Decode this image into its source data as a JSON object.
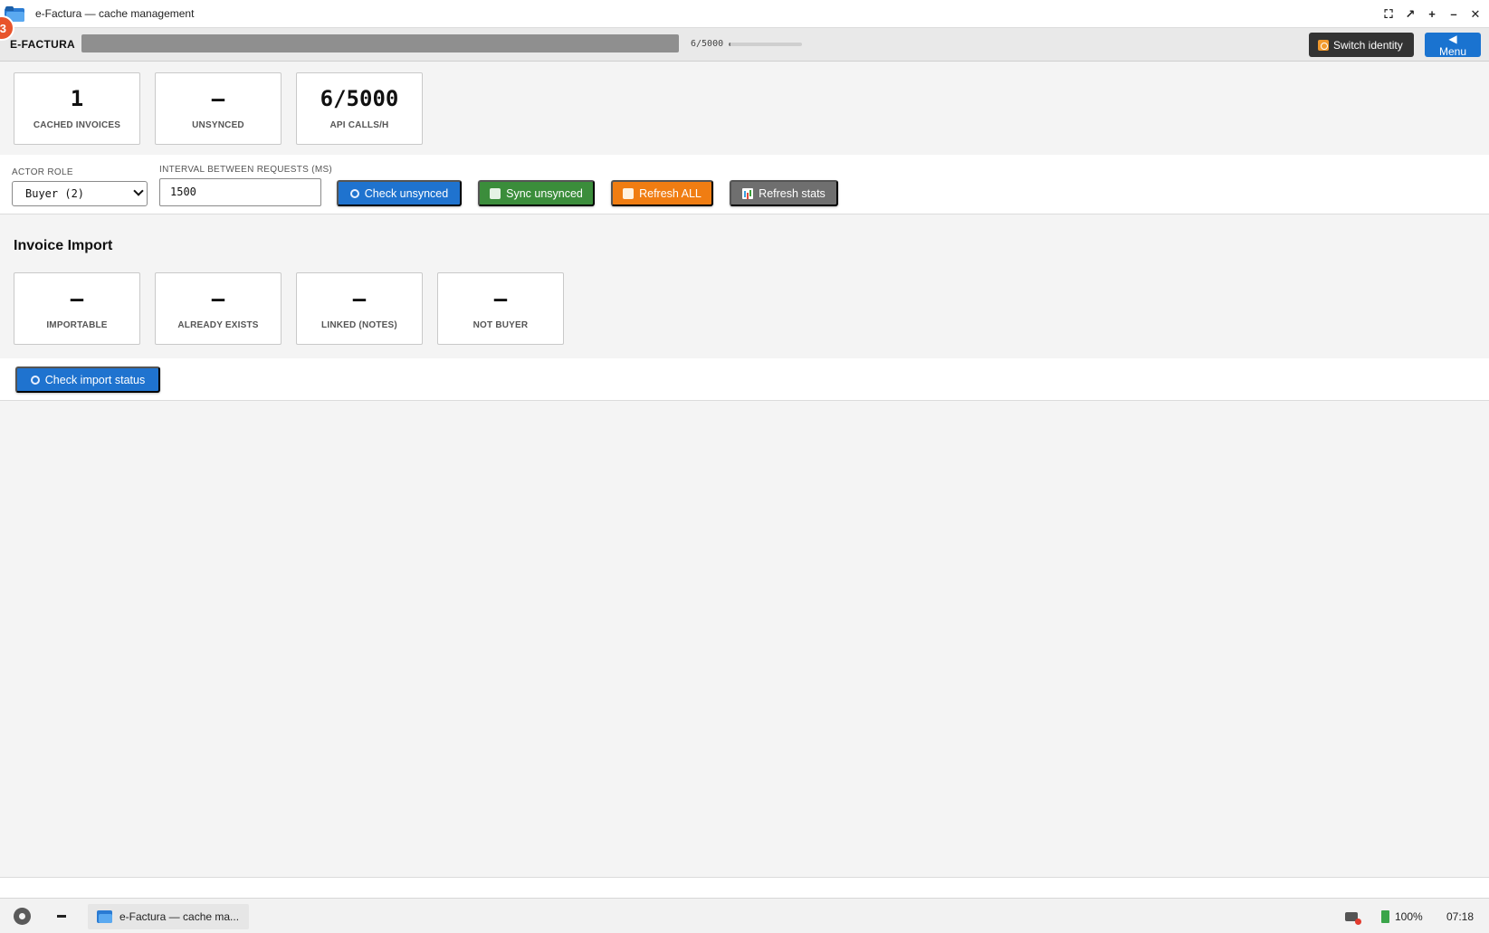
{
  "window": {
    "title": "e-Factura — cache management",
    "controls": [
      "fullscreen",
      "restore",
      "maximize",
      "minimize",
      "close"
    ]
  },
  "notification_badge": "3",
  "header": {
    "brand": "E-FACTURA",
    "quota_text": "6/5000",
    "quota_fraction": 0.0012,
    "switch_identity_label": "Switch identity",
    "menu_label": "◀ Menu"
  },
  "stats": [
    {
      "value": "1",
      "label": "CACHED INVOICES"
    },
    {
      "value": "–",
      "label": "UNSYNCED"
    },
    {
      "value": "6/5000",
      "label": "API CALLS/H"
    }
  ],
  "controls": {
    "actor_role_label": "ACTOR ROLE",
    "actor_role_value": "Buyer (2)",
    "interval_label": "INTERVAL BETWEEN REQUESTS (MS)",
    "interval_value": "1500",
    "buttons": {
      "check_unsynced": "Check unsynced",
      "sync_unsynced": "Sync unsynced",
      "refresh_all": "Refresh ALL",
      "refresh_stats": "Refresh stats"
    }
  },
  "import": {
    "title": "Invoice Import",
    "stats": [
      {
        "value": "–",
        "label": "IMPORTABLE"
      },
      {
        "value": "–",
        "label": "ALREADY EXISTS"
      },
      {
        "value": "–",
        "label": "LINKED (NOTES)"
      },
      {
        "value": "–",
        "label": "NOT BUYER"
      }
    ],
    "check_button": "Check import status"
  },
  "taskbar": {
    "task_label": "e-Factura — cache ma...",
    "battery": "100%",
    "clock": "07:18"
  },
  "colors": {
    "primary": "#1f73cf",
    "success": "#3b8d3b",
    "warning": "#f07d12",
    "neutral": "#6f6f6f",
    "dark": "#333333"
  }
}
